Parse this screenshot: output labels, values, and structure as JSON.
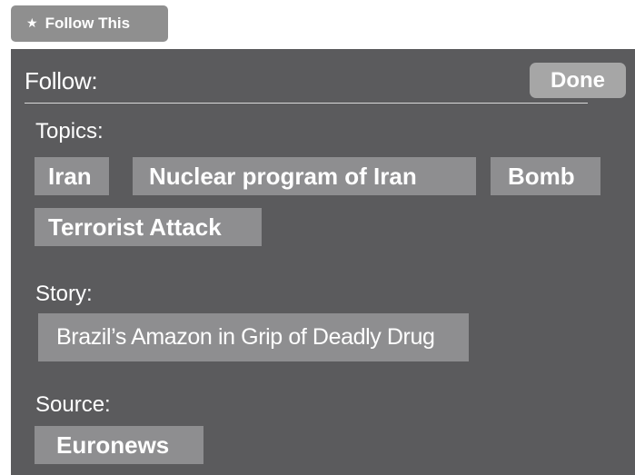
{
  "follow_button": {
    "star_icon": "★",
    "label": "Follow This"
  },
  "panel": {
    "title": "Follow:",
    "done_label": "Done",
    "topics_label": "Topics:",
    "topics": [
      "Iran",
      "Nuclear program of Iran",
      "Bomb",
      "Terrorist Attack"
    ],
    "story_label": "Story:",
    "story": "Brazil’s Amazon in Grip of Deadly Drug",
    "source_label": "Source:",
    "source": "Euronews"
  },
  "colors": {
    "panel_bg": "#5b5b5d",
    "tag_bg": "#8e8e90",
    "button_bg": "#8f8f8f",
    "done_bg": "#a6a6a6",
    "text": "#ffffff"
  }
}
